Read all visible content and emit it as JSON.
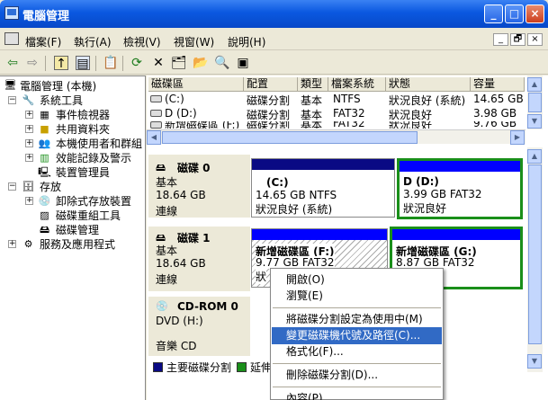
{
  "window": {
    "title": "電腦管理",
    "minimize": "_",
    "maximize": "□",
    "close": "×"
  },
  "menubar": {
    "items": [
      "檔案(F)",
      "執行(A)",
      "檢視(V)",
      "視窗(W)",
      "說明(H)"
    ],
    "mdi_min": "_",
    "mdi_restore": "🗗",
    "mdi_close": "×"
  },
  "toolbar": {
    "icons": [
      "back-arrow-icon",
      "forward-arrow-icon",
      "up-folder-icon",
      "show-hide-tree-icon",
      "properties-icon",
      "refresh-icon",
      "delete-icon",
      "open-icon",
      "explore-icon",
      "search-icon",
      "help-icon"
    ]
  },
  "tree": {
    "root": "電腦管理 (本機)",
    "system_tools": "系統工具",
    "event_viewer": "事件檢視器",
    "shared_folders": "共用資料夾",
    "local_users": "本機使用者和群組",
    "perf_logs": "效能記錄及警示",
    "device_manager": "裝置管理員",
    "storage": "存放",
    "removable": "卸除式存放裝置",
    "defrag": "磁碟重組工具",
    "disk_mgmt": "磁碟管理",
    "services": "服務及應用程式",
    "expand_plus": "+",
    "expand_minus": "−"
  },
  "volumes": {
    "headers": [
      "磁碟區",
      "配置",
      "類型",
      "檔案系統",
      "狀態",
      "容量"
    ],
    "rows": [
      [
        "(C:)",
        "磁碟分割",
        "基本",
        "NTFS",
        "狀況良好 (系統)",
        "14.65 GB"
      ],
      [
        "D (D:)",
        "磁碟分割",
        "基本",
        "FAT32",
        "狀況良好",
        "3.98 GB"
      ],
      [
        "新增磁碟區 (F:)",
        "磁碟分割",
        "基本",
        "FAT32",
        "狀況良好",
        "9.76 GB"
      ]
    ]
  },
  "disks": [
    {
      "name": "磁碟 0",
      "type": "基本",
      "size": "18.64 GB",
      "status": "連線"
    },
    {
      "name": "磁碟 1",
      "type": "基本",
      "size": "18.64 GB",
      "status": "連線"
    },
    {
      "name": "CD-ROM 0",
      "type": "DVD (H:)",
      "size": "",
      "status": "音樂 CD"
    }
  ],
  "partitions": {
    "c": {
      "name": "(C:)",
      "info": "14.65 GB NTFS",
      "status": "狀況良好 (系統)"
    },
    "d": {
      "name": "D  (D:)",
      "info": "3.99 GB FAT32",
      "status": "狀況良好"
    },
    "f": {
      "name": "新增磁碟區  (F:)",
      "info": "9.77 GB FAT32",
      "status": "狀"
    },
    "g": {
      "name": "新增磁碟區  (G:)",
      "info": "8.87 GB FAT32",
      "status": ""
    }
  },
  "legend": {
    "primary": "主要磁碟分割",
    "extended": "延伸"
  },
  "colors": {
    "primary": "#0a0a84",
    "logical": "#0000ff",
    "extended": "#1a8f1a",
    "selection": "#316ac5",
    "titlebar": "#0a58e0"
  },
  "context_menu": {
    "items": [
      "開啟(O)",
      "瀏覽(E)",
      "將磁碟分割設定為使用中(M)",
      "變更磁碟機代號及路徑(C)...",
      "格式化(F)...",
      "刪除磁碟分割(D)...",
      "內容(P)"
    ],
    "highlighted": "變更磁碟機代號及路徑(C)..."
  }
}
